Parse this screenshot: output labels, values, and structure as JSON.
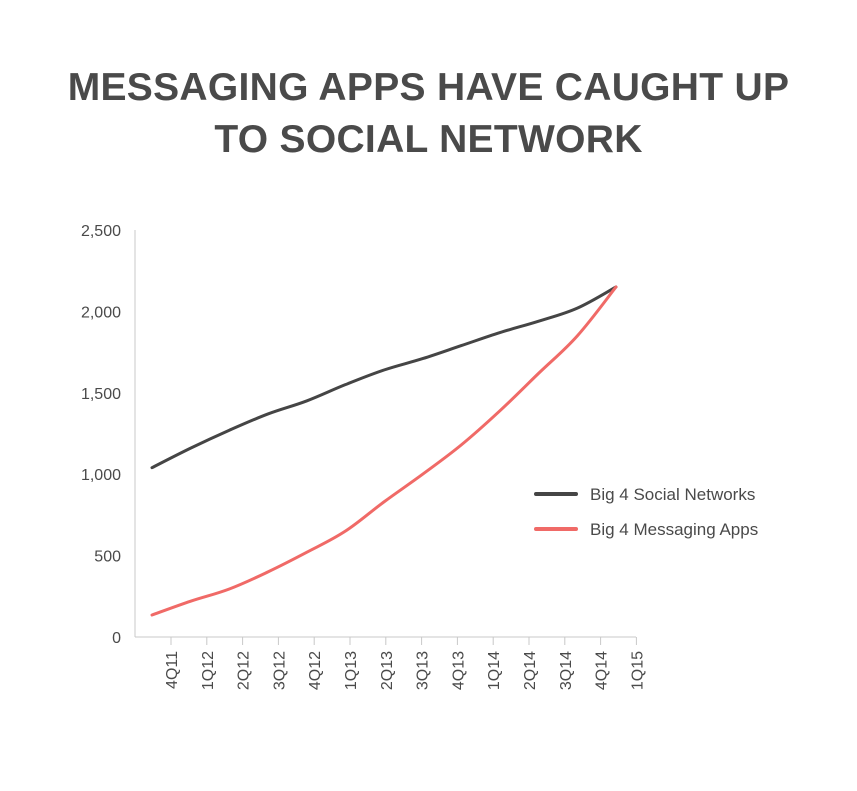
{
  "title": {
    "line1": "MESSAGING APPS HAVE CAUGHT UP",
    "line2": "TO SOCIAL NETWORK"
  },
  "colors": {
    "text": "#4a4a4a",
    "axis": "#c8c8c8",
    "series_social": "#454545",
    "series_messaging": "#f06a67"
  },
  "chart_data": {
    "type": "line",
    "categories": [
      "4Q11",
      "1Q12",
      "2Q12",
      "3Q12",
      "4Q12",
      "1Q13",
      "2Q13",
      "3Q13",
      "4Q13",
      "1Q14",
      "2Q14",
      "3Q14",
      "4Q14",
      "1Q15"
    ],
    "ylim": [
      0,
      2500
    ],
    "yticks": [
      0,
      500,
      1000,
      1500,
      2000,
      2500
    ],
    "ytick_labels": [
      "0",
      "500",
      "1,000",
      "1,500",
      "2,000",
      "2,500"
    ],
    "grid": false,
    "legend_position": "right",
    "series": [
      {
        "name": "Big 4 Social Networks",
        "color": "#454545",
        "values": [
          1040,
          1160,
          1270,
          1370,
          1450,
          1550,
          1640,
          1710,
          1790,
          1870,
          1940,
          2020,
          2150
        ]
      },
      {
        "name": "Big 4 Messaging Apps",
        "color": "#f06a67",
        "values": [
          135,
          220,
          295,
          400,
          520,
          650,
          830,
          1000,
          1180,
          1390,
          1620,
          1850,
          2150
        ]
      }
    ]
  }
}
